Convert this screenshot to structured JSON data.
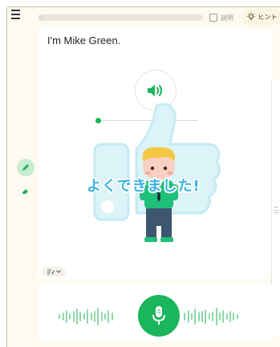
{
  "lesson": {
    "sentence": "I'm Mike Green.",
    "progress_fraction": 0.02
  },
  "header": {
    "explain_label": "説明",
    "hint_label": "ヒント"
  },
  "feedback": {
    "message": "よくできました!"
  },
  "controls": {
    "audio_position_fraction": 0.0,
    "mode_icon": "pen-lines-icon"
  },
  "colors": {
    "accent_green": "#1bb55c",
    "feedback_blue": "#3ab4e0",
    "thumb_bg": "#dcf3f8",
    "panel_cream": "#fdfaf0"
  }
}
